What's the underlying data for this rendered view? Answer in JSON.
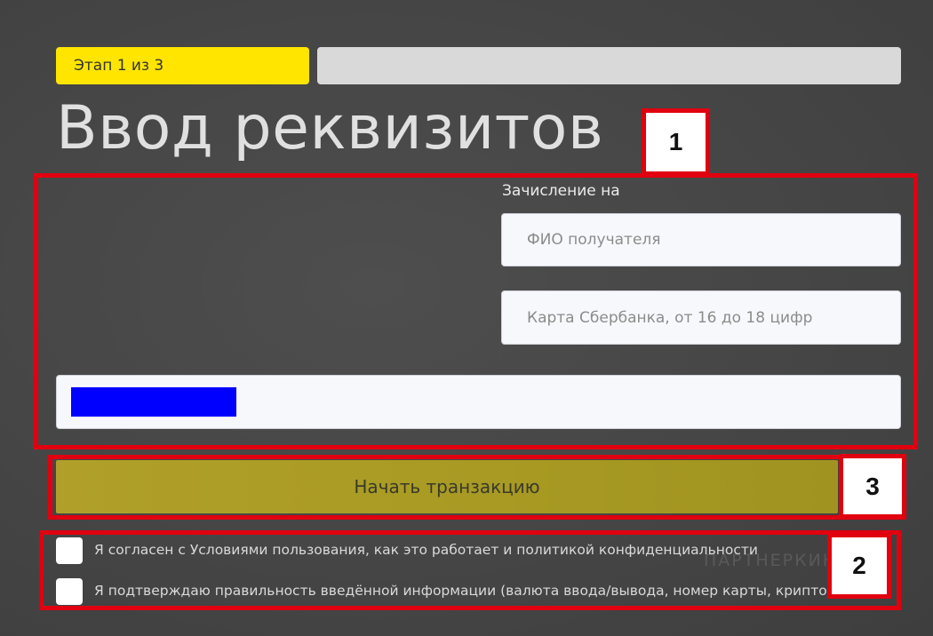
{
  "progress": {
    "step_label": "Этап 1 из 3",
    "current_step": 1,
    "total_steps": 3
  },
  "page": {
    "title": "Ввод реквизитов"
  },
  "form": {
    "credit_label": "Зачисление на",
    "recipient_name_placeholder": "ФИО получателя",
    "card_placeholder": "Карта Сбербанка, от 16 до 18 цифр",
    "submit_label": "Начать транзакцию"
  },
  "agreements": {
    "terms_label": "Я согласен с Условиями пользования, как это работает и политикой конфиденциальности",
    "confirm_label": "Я подтверждаю правильность введённой информации (валюта ввода/вывода, номер карты, криптокошелька)"
  },
  "annotations": {
    "badge_1": "1",
    "badge_2": "2",
    "badge_3": "3",
    "color": "#e0000f"
  },
  "watermark": {
    "text": "ПАРТНЕРКИН"
  },
  "colors": {
    "step_active": "#ffe500",
    "step_inactive": "#d9d9d9",
    "button": "#a89a23",
    "redaction": "#0000ff"
  }
}
